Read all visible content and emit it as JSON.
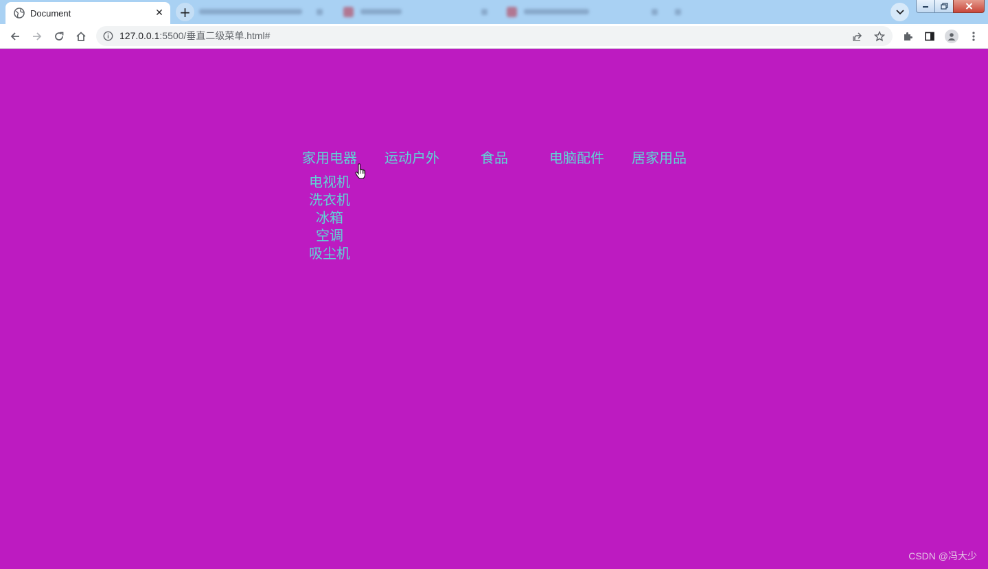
{
  "browser": {
    "active_tab": {
      "title": "Document",
      "icon": "globe-icon"
    },
    "url": {
      "host": "127.0.0.1",
      "path": ":5500/垂直二级菜单.html#"
    }
  },
  "menu": {
    "items": [
      {
        "label": "家用电器",
        "submenu": [
          "电视机",
          "洗衣机",
          "冰箱",
          "空调",
          "吸尘机"
        ]
      },
      {
        "label": "运动户外"
      },
      {
        "label": "食品"
      },
      {
        "label": "电脑配件"
      },
      {
        "label": "居家用品"
      }
    ]
  },
  "watermark": "CSDN @冯大少",
  "colors": {
    "page_background": "#bd1bc1",
    "menu_text": "#5fd5d5",
    "titlebar": "#a9d1f3"
  }
}
